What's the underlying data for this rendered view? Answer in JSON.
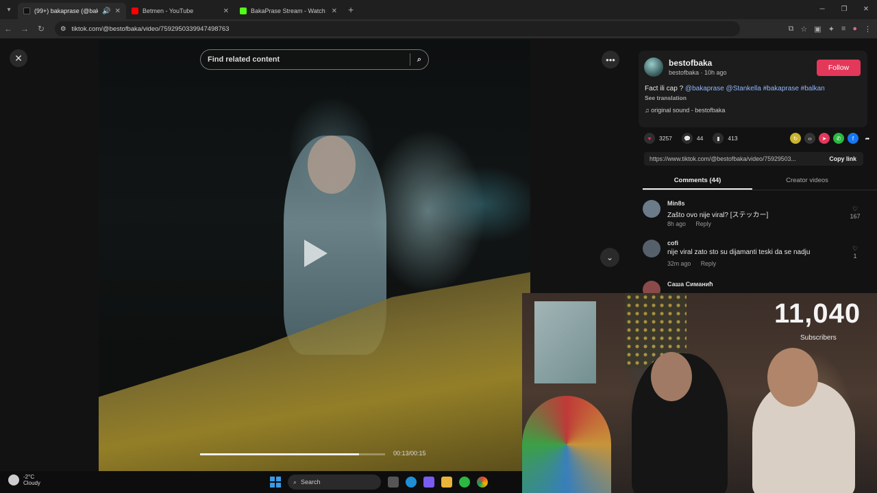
{
  "browser": {
    "tabs": [
      {
        "title": "(99+) bakaprase (@bakapra...",
        "favicon_color": "#111111",
        "active": true
      },
      {
        "title": "Betmen - YouTube",
        "favicon_color": "#ff0000",
        "active": false
      },
      {
        "title": "BakaPrase Stream - Watch Live",
        "favicon_color": "#53fc18",
        "active": false
      }
    ],
    "url": "tiktok.com/@bestofbaka/video/7592950339947498763"
  },
  "video": {
    "search_placeholder": "Find related content",
    "progress": 0.86,
    "time": "00:13/00:15"
  },
  "post": {
    "username": "bestofbaka",
    "subline": "bestofbaka · 10h ago",
    "follow_label": "Follow",
    "desc_text": "Fact ili cap ?",
    "desc_tags": "@bakaprase @Stankella #bakaprase #balkan",
    "see_translation": "See translation",
    "sound": "original sound - bestofbaka",
    "likes": "3257",
    "comments": "44",
    "saves": "413",
    "link": "https://www.tiktok.com/@bestofbaka/video/75929503...",
    "copy_link": "Copy link",
    "tab_comments": "Comments (44)",
    "tab_creator": "Creator videos"
  },
  "comments": [
    {
      "name": "Min8s",
      "text": "Zašto ovo nije viral? [ステッカー]",
      "time": "8h ago",
      "reply": "Reply",
      "likes": "167",
      "avatar_color": "#6b7b8a"
    },
    {
      "name": "cofi",
      "text": "nije viral zato sto su dijamanti teski da se nadju",
      "time": "32m ago",
      "reply": "Reply",
      "likes": "1",
      "avatar_color": "#55606a"
    },
    {
      "name": "Саша Симанић",
      "text": "",
      "time": "",
      "reply": "",
      "likes": "",
      "avatar_color": "#8a4a4a"
    }
  ],
  "stream_overlay": {
    "subscribers_count": "11,040",
    "subscribers_label": "Subscribers"
  },
  "taskbar": {
    "temp": "-2°C",
    "weather": "Cloudy",
    "search": "Search"
  }
}
